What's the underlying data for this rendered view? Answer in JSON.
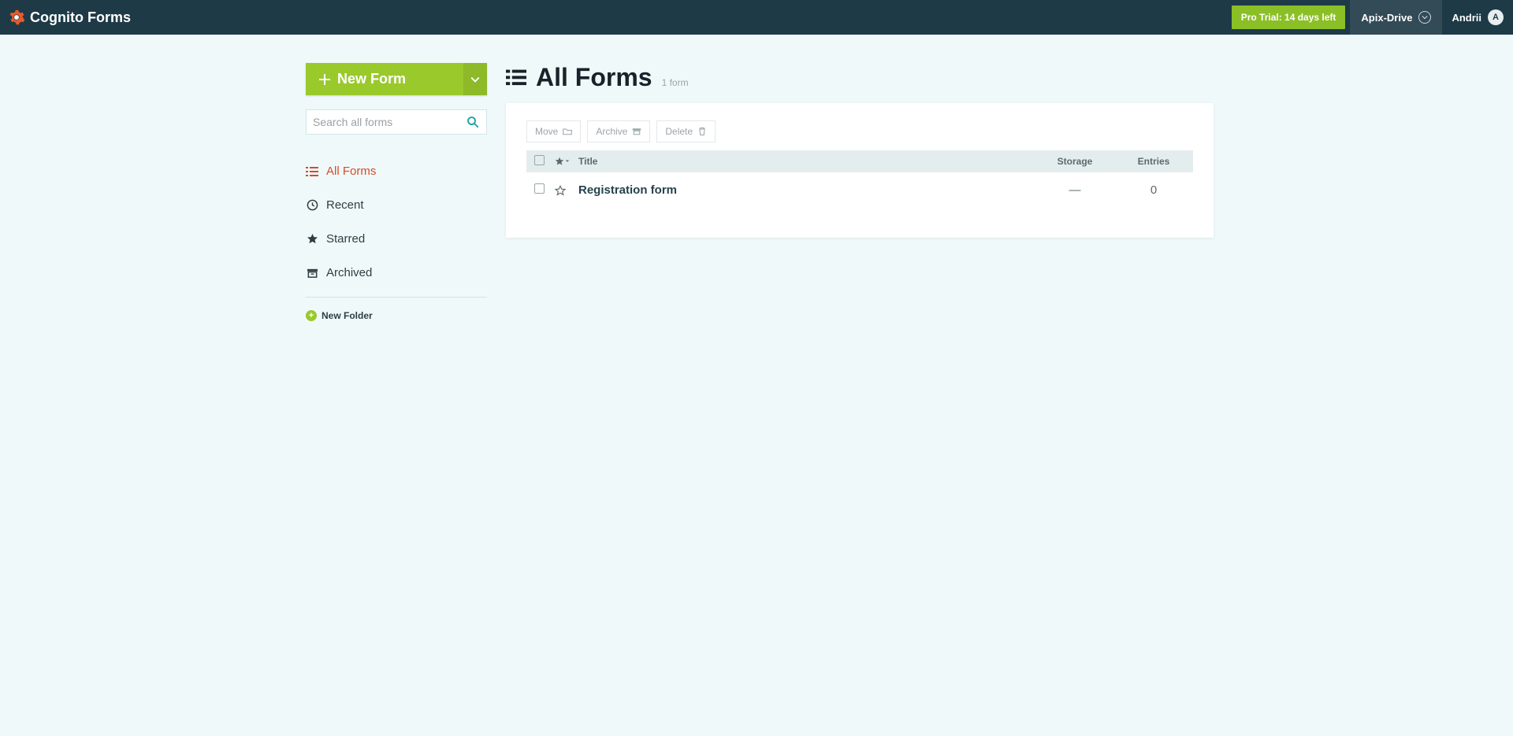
{
  "header": {
    "brand": "Cognito Forms",
    "trial": "Pro Trial: 14 days left",
    "org": "Apix-Drive",
    "user": "Andrii",
    "avatar_initial": "A"
  },
  "sidebar": {
    "new_form": "New Form",
    "search_placeholder": "Search all forms",
    "nav": [
      {
        "label": "All Forms"
      },
      {
        "label": "Recent"
      },
      {
        "label": "Starred"
      },
      {
        "label": "Archived"
      }
    ],
    "new_folder": "New Folder"
  },
  "main": {
    "title": "All Forms",
    "count_label": "1 form",
    "actions": {
      "move": "Move",
      "archive": "Archive",
      "delete": "Delete"
    },
    "columns": {
      "title": "Title",
      "storage": "Storage",
      "entries": "Entries"
    },
    "rows": [
      {
        "title": "Registration form",
        "storage": "—",
        "entries": "0"
      }
    ]
  }
}
